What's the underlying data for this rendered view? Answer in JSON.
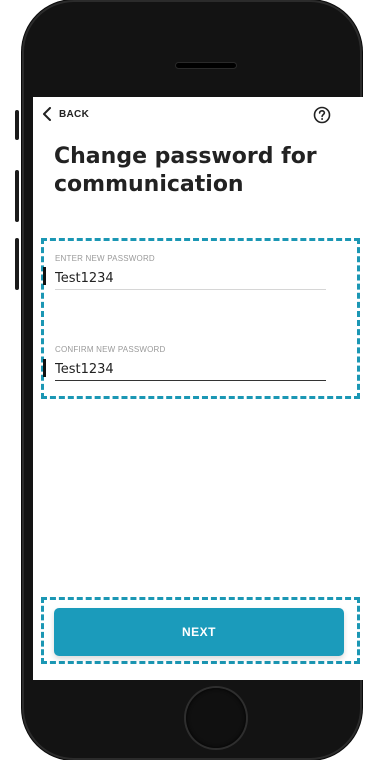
{
  "header": {
    "back_label": "BACK",
    "back_icon": "chevron-left-icon",
    "help_icon": "question-circle-icon"
  },
  "page": {
    "title": "Change password for communication"
  },
  "form": {
    "new_password": {
      "label": "ENTER NEW PASSWORD",
      "value": "Test1234"
    },
    "confirm_password": {
      "label": "CONFIRM NEW PASSWORD",
      "value": "Test1234"
    }
  },
  "actions": {
    "next_label": "NEXT"
  },
  "colors": {
    "accent": "#1b9bbb",
    "highlight_frame": "#1b97b4",
    "device_body": "#131313"
  }
}
